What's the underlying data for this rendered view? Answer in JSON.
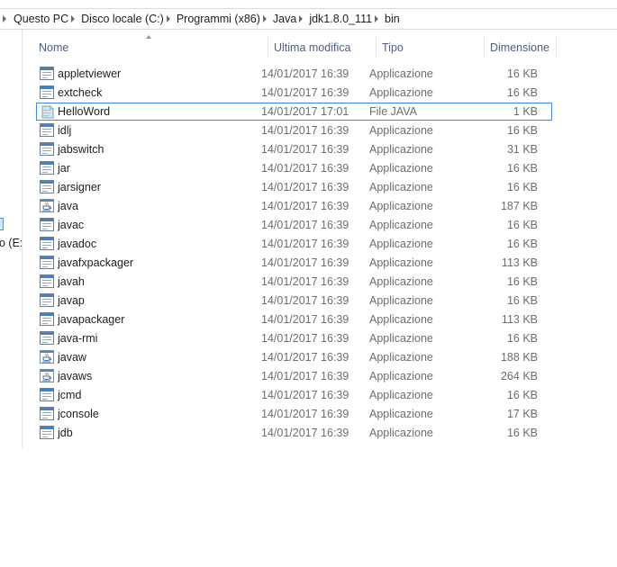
{
  "breadcrumb": [
    "Questo PC",
    "Disco locale (C:)",
    "Programmi (x86)",
    "Java",
    "jdk1.8.0_111",
    "bin"
  ],
  "nav": {
    "partial_label": "o (E:"
  },
  "columns": {
    "name": "Nome",
    "modified": "Ultima modifica",
    "type": "Tipo",
    "size": "Dimensione"
  },
  "files": [
    {
      "name": "appletviewer",
      "modified": "14/01/2017 16:39",
      "type": "Applicazione",
      "size": "16 KB",
      "icon": "app-window-icon"
    },
    {
      "name": "extcheck",
      "modified": "14/01/2017 16:39",
      "type": "Applicazione",
      "size": "16 KB",
      "icon": "app-window-icon"
    },
    {
      "name": "HelloWord",
      "modified": "14/01/2017 17:01",
      "type": "File JAVA",
      "size": "1 KB",
      "icon": "java-file-icon",
      "selected": true
    },
    {
      "name": "idlj",
      "modified": "14/01/2017 16:39",
      "type": "Applicazione",
      "size": "16 KB",
      "icon": "app-window-icon"
    },
    {
      "name": "jabswitch",
      "modified": "14/01/2017 16:39",
      "type": "Applicazione",
      "size": "31 KB",
      "icon": "app-window-icon"
    },
    {
      "name": "jar",
      "modified": "14/01/2017 16:39",
      "type": "Applicazione",
      "size": "16 KB",
      "icon": "app-window-icon"
    },
    {
      "name": "jarsigner",
      "modified": "14/01/2017 16:39",
      "type": "Applicazione",
      "size": "16 KB",
      "icon": "app-window-icon"
    },
    {
      "name": "java",
      "modified": "14/01/2017 16:39",
      "type": "Applicazione",
      "size": "187 KB",
      "icon": "java-cup-icon"
    },
    {
      "name": "javac",
      "modified": "14/01/2017 16:39",
      "type": "Applicazione",
      "size": "16 KB",
      "icon": "app-window-icon"
    },
    {
      "name": "javadoc",
      "modified": "14/01/2017 16:39",
      "type": "Applicazione",
      "size": "16 KB",
      "icon": "app-window-icon"
    },
    {
      "name": "javafxpackager",
      "modified": "14/01/2017 16:39",
      "type": "Applicazione",
      "size": "113 KB",
      "icon": "app-window-icon"
    },
    {
      "name": "javah",
      "modified": "14/01/2017 16:39",
      "type": "Applicazione",
      "size": "16 KB",
      "icon": "app-window-icon"
    },
    {
      "name": "javap",
      "modified": "14/01/2017 16:39",
      "type": "Applicazione",
      "size": "16 KB",
      "icon": "app-window-icon"
    },
    {
      "name": "javapackager",
      "modified": "14/01/2017 16:39",
      "type": "Applicazione",
      "size": "113 KB",
      "icon": "app-window-icon"
    },
    {
      "name": "java-rmi",
      "modified": "14/01/2017 16:39",
      "type": "Applicazione",
      "size": "16 KB",
      "icon": "app-window-icon"
    },
    {
      "name": "javaw",
      "modified": "14/01/2017 16:39",
      "type": "Applicazione",
      "size": "188 KB",
      "icon": "java-cup-icon"
    },
    {
      "name": "javaws",
      "modified": "14/01/2017 16:39",
      "type": "Applicazione",
      "size": "264 KB",
      "icon": "java-cup-icon"
    },
    {
      "name": "jcmd",
      "modified": "14/01/2017 16:39",
      "type": "Applicazione",
      "size": "16 KB",
      "icon": "app-window-icon"
    },
    {
      "name": "jconsole",
      "modified": "14/01/2017 16:39",
      "type": "Applicazione",
      "size": "17 KB",
      "icon": "app-window-icon"
    },
    {
      "name": "jdb",
      "modified": "14/01/2017 16:39",
      "type": "Applicazione",
      "size": "16 KB",
      "icon": "app-window-icon"
    }
  ],
  "colors": {
    "selection_border": "#3c8ed8",
    "header_text": "#4c607a"
  }
}
